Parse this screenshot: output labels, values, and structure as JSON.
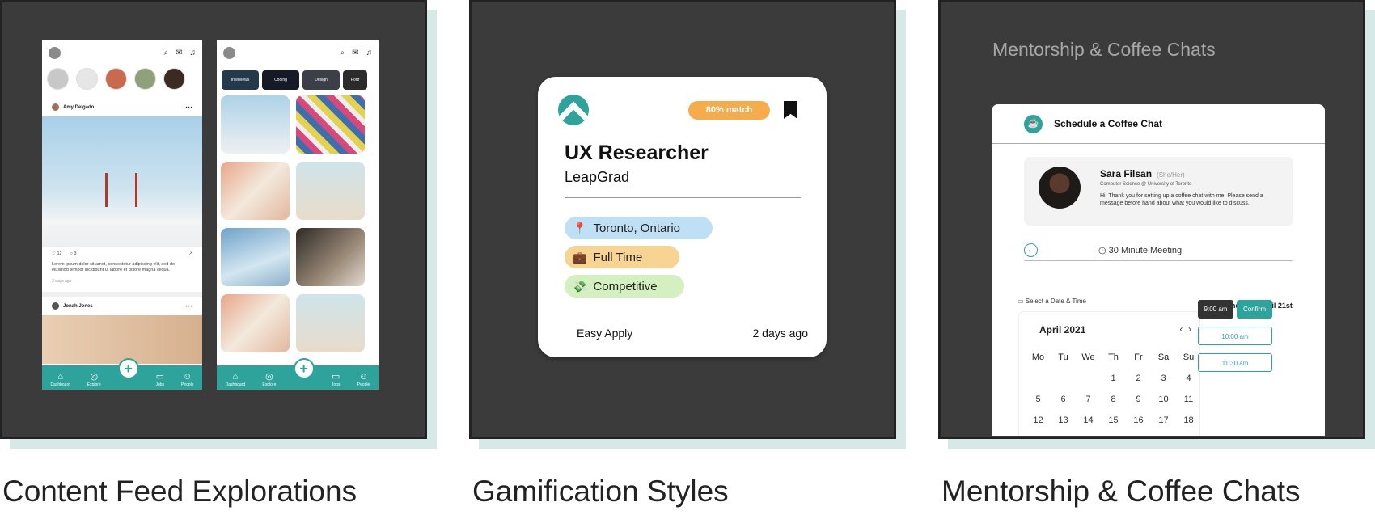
{
  "cards": [
    {
      "caption": "Content Feed Explorations"
    },
    {
      "caption": "Gamification Styles"
    },
    {
      "caption": "Mentorship & Coffee Chats"
    }
  ],
  "feed": {
    "post1_author": "Amy Delgado",
    "post1_likes": "12",
    "post1_comments": "3",
    "post1_text": "Lorem ipsum dolor sit amet, consectetur adipiscing elit, sed do eiusmod tempor incididunt ut labore et dolore magna aliqua.",
    "post1_time": "2 days ago",
    "post2_author": "Jonah Jones",
    "tabs": [
      "Dashboard",
      "Explore",
      "Jobs",
      "People"
    ],
    "chips": [
      "Interviews",
      "Coding",
      "Design",
      "Portf"
    ]
  },
  "job": {
    "match": "80%  match",
    "title": "UX Researcher",
    "company": "LeapGrad",
    "location": "Toronto, Ontario",
    "type": "Full Time",
    "pay": "Competitive",
    "apply": "Easy Apply",
    "posted": "2 days ago"
  },
  "mentor": {
    "section_title": "Mentorship & Coffee Chats",
    "header": "Schedule a Coffee Chat",
    "name": "Sara Filsan",
    "pronouns": "(She/Her)",
    "program": "Computer Science @ University of Toronto",
    "message": "Hi! Thank you for setting up a coffee chat with me. Please send a message before hand about what you would like to discuss.",
    "meeting": "30 Minute Meeting",
    "select_label": "Select a Date & Time",
    "month": "April 2021",
    "weekdays": [
      "Mo",
      "Tu",
      "We",
      "Th",
      "Fr",
      "Sa",
      "Su"
    ],
    "dates": [
      "",
      "",
      "",
      "1",
      "2",
      "3",
      "4",
      "5",
      "6",
      "7",
      "8",
      "9",
      "10",
      "11",
      "12",
      "13",
      "14",
      "15",
      "16",
      "17",
      "18"
    ],
    "selected_day": "Wednesday, April 21st",
    "slot1": "9:00 am",
    "confirm": "Confirm",
    "slot2": "10:00 am",
    "slot3": "11:30 am"
  },
  "colors": {
    "teal": "#2ea39c",
    "orange": "#f6ac4a",
    "blue_tag": "#bfe0f4",
    "yellow_tag": "#f8d492",
    "green_tag": "#d4efc0"
  }
}
